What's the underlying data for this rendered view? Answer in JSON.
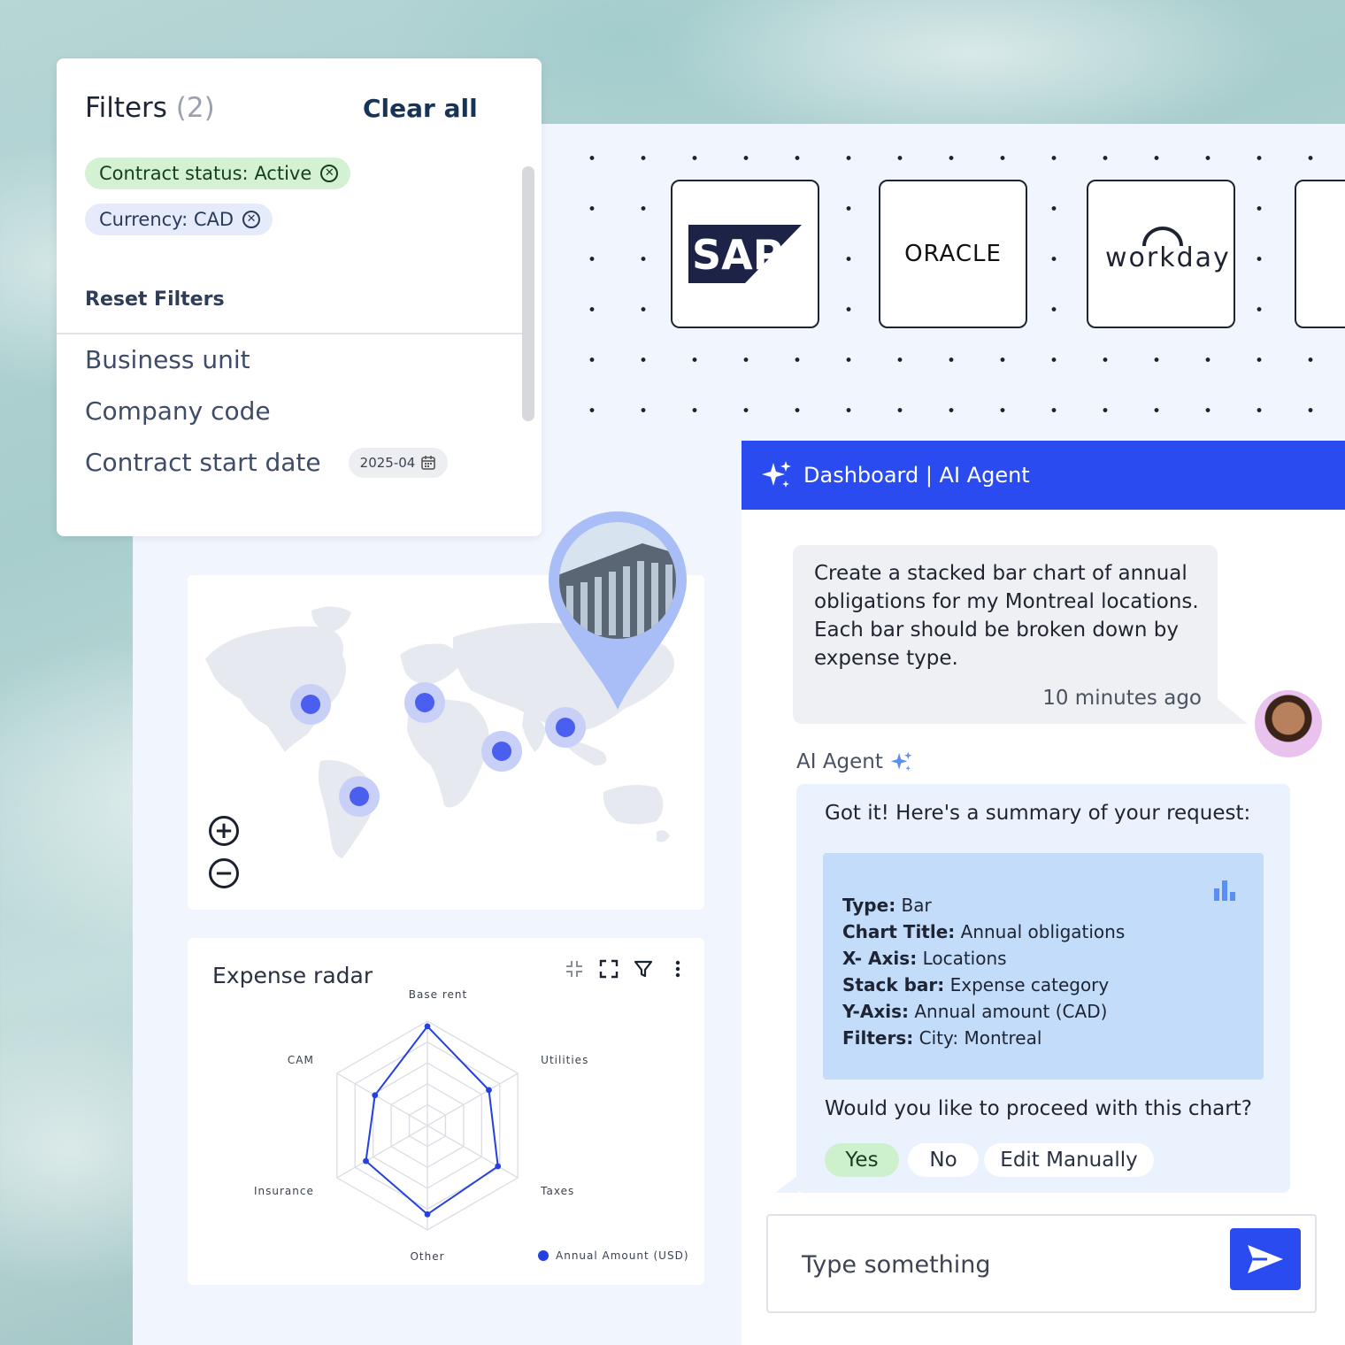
{
  "filters": {
    "title": "Filters",
    "count": "(2)",
    "clear_all": "Clear all",
    "chips": [
      {
        "key": "Contract status:",
        "value": "Active"
      },
      {
        "key": "Currency:",
        "value": "CAD"
      }
    ],
    "reset": "Reset Filters",
    "fields": [
      "Business unit",
      "Company code",
      "Contract start date"
    ],
    "date_value": "2025-04"
  },
  "integrations": [
    "SAP",
    "ORACLE",
    "workday"
  ],
  "radar": {
    "title": "Expense radar",
    "legend": "Annual Amount (USD)"
  },
  "chart_data": {
    "type": "radar",
    "axes": [
      "Base rent",
      "Utilities",
      "Taxes",
      "Other",
      "Insurance",
      "CAM"
    ],
    "series": [
      {
        "name": "Annual Amount (USD)",
        "values": [
          0.95,
          0.68,
          0.78,
          0.85,
          0.68,
          0.58
        ]
      }
    ],
    "rings": 5,
    "range": [
      0,
      1
    ]
  },
  "chat": {
    "header": "Dashboard | AI Agent",
    "user_message": "Create a stacked bar chart of annual obligations for my Montreal locations. Each bar should be broken down by expense type.",
    "user_time": "10 minutes ago",
    "agent_label": "AI Agent",
    "agent_intro": "Got it! Here's a summary of your request:",
    "summary": [
      {
        "key": "Type:",
        "value": "Bar"
      },
      {
        "key": "Chart Title:",
        "value": "Annual obligations"
      },
      {
        "key": "X- Axis:",
        "value": "Locations"
      },
      {
        "key": "Stack bar:",
        "value": "Expense category"
      },
      {
        "key": "Y-Axis:",
        "value": "Annual amount (CAD)"
      },
      {
        "key": "Filters:",
        "value": "City: Montreal"
      }
    ],
    "question": "Would you like to proceed with this chart?",
    "choices": [
      "Yes",
      "No",
      "Edit Manually"
    ],
    "input_placeholder": "Type something"
  },
  "colors": {
    "accent": "#2a4bf0",
    "map_marker": "#4a5ef0",
    "radar_line": "#2440e0"
  }
}
